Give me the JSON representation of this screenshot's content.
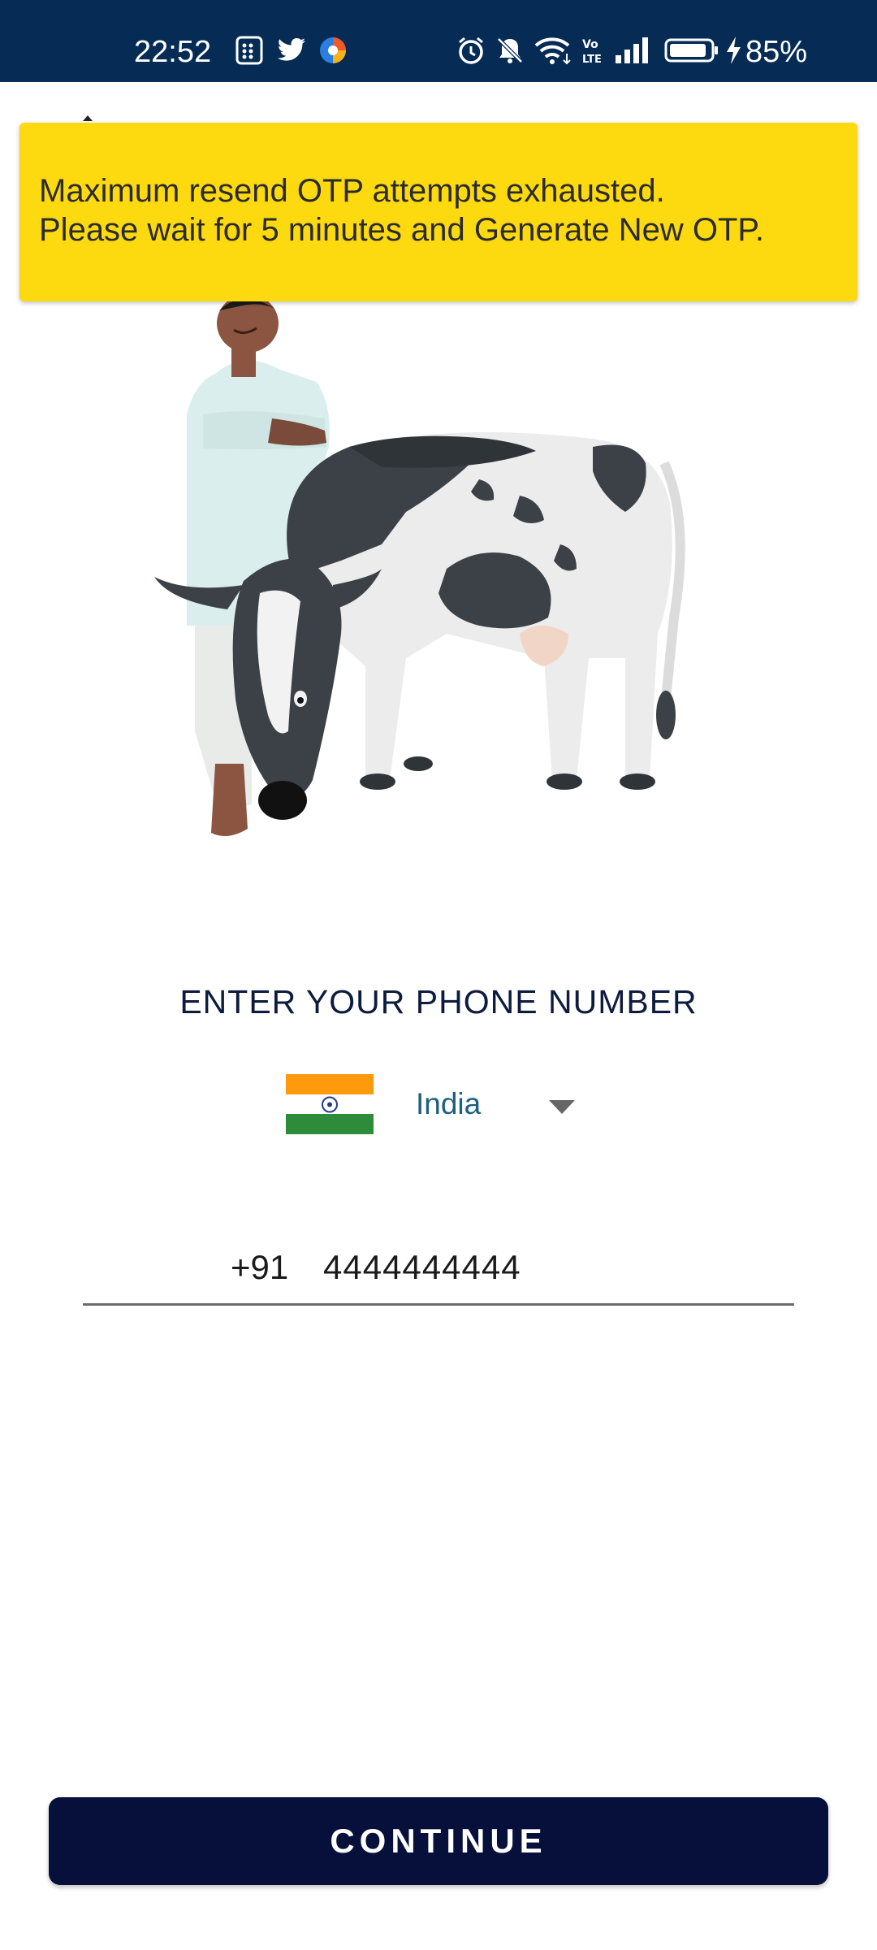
{
  "status_bar": {
    "time": "22:52",
    "notification_icons": [
      "notification-grid-icon",
      "twitter-icon",
      "browser-icon"
    ],
    "system_icons": [
      "alarm-icon",
      "mute-icon",
      "wifi-icon",
      "volte-icon",
      "signal-icon",
      "battery-icon",
      "charging-icon"
    ],
    "battery": "85%"
  },
  "toast": {
    "line1": "Maximum resend OTP attempts exhausted.",
    "line2": "Please wait for 5 minutes and Generate New OTP.",
    "background_color": "#fdd90f"
  },
  "phone_form": {
    "title": "ENTER YOUR PHONE NUMBER",
    "country": "India",
    "dial_code": "+91",
    "phone_value": "4444444444"
  },
  "actions": {
    "continue_label": "CONTINUE"
  },
  "colors": {
    "status_bar": "#062b55",
    "primary_button": "#06103a",
    "country_text": "#1d5f7f"
  }
}
